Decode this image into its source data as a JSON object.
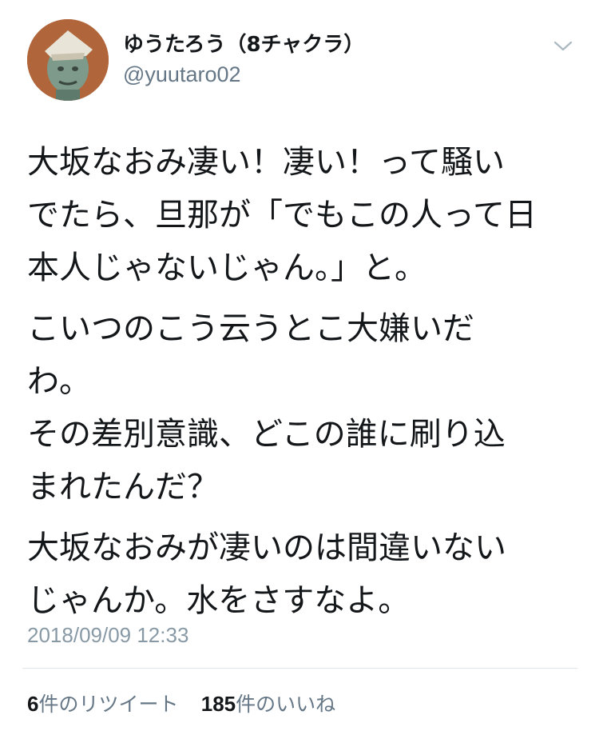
{
  "author": {
    "display_name": "ゆうたろう（8チャクラ）",
    "handle": "@yuutaro02",
    "avatar_icon": "avatar-photo"
  },
  "tweet": {
    "paragraphs": [
      {
        "lines": [
          "大坂なおみ凄い！凄い！って騒い",
          "でたら、旦那が「でもこの人って日",
          "本人じゃないじゃん。」と。"
        ]
      },
      {
        "lines": [
          "こいつのこう云うとこ大嫌いだ",
          "わ。",
          "その差別意識、どこの誰に刷り込",
          "まれたんだ？"
        ]
      },
      {
        "lines": [
          "大坂なおみが凄いのは間違いない",
          "じゃんか。水をさすなよ。"
        ]
      }
    ],
    "timestamp": "2018/09/09 12:33"
  },
  "stats": {
    "retweets_count": "6",
    "retweets_label": "件のリツイート",
    "likes_count": "185",
    "likes_label": "件のいいね"
  },
  "colors": {
    "text": "#14171a",
    "secondary": "#657786",
    "timestamp": "#8899a6",
    "divider": "#e1e8ed"
  },
  "icons": {
    "menu_caret": "chevron-down-icon"
  }
}
